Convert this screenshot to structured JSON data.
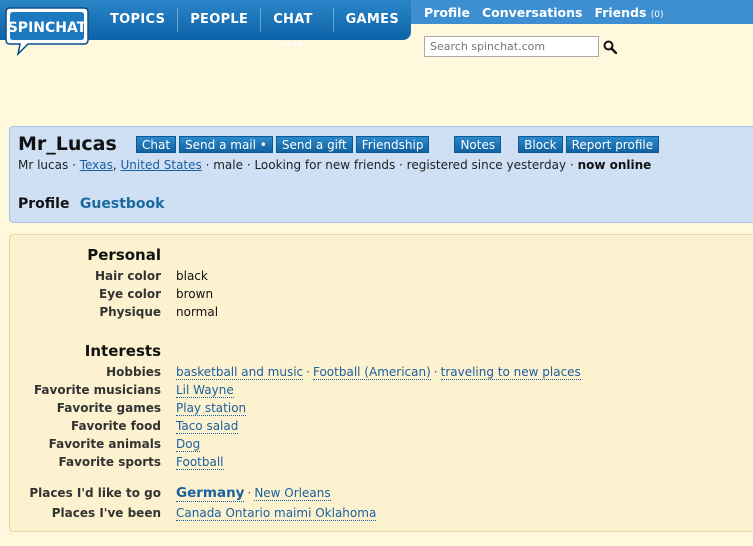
{
  "brand": {
    "logo_text": "SPINCHAT"
  },
  "main_nav": {
    "topics": "TOPICS",
    "people": "PEOPLE",
    "chat": "CHAT",
    "games": "GAMES"
  },
  "user_nav": {
    "profile": "Profile",
    "conversations": "Conversations",
    "friends": "Friends",
    "friends_count": "(0)"
  },
  "search": {
    "placeholder": "Search spinchat.com"
  },
  "profile": {
    "username": "Mr_Lucas",
    "actions": {
      "chat": "Chat",
      "send_mail": "Send a mail •",
      "send_gift": "Send a gift",
      "friendship": "Friendship",
      "notes": "Notes",
      "block": "Block",
      "report": "Report profile"
    },
    "display_name": "Mr lucas",
    "state": "Texas",
    "country": "United States",
    "gender": "male",
    "looking_for": "Looking for new friends",
    "registered": "registered since yesterday",
    "status": "now online",
    "tabs": {
      "profile": "Profile",
      "guestbook": "Guestbook"
    }
  },
  "personal": {
    "title": "Personal",
    "hair_color": {
      "label": "Hair color",
      "value": "black"
    },
    "eye_color": {
      "label": "Eye color",
      "value": "brown"
    },
    "physique": {
      "label": "Physique",
      "value": "normal"
    }
  },
  "interests": {
    "title": "Interests",
    "hobbies": {
      "label": "Hobbies",
      "values": [
        "basketball and music",
        "Football (American)",
        "traveling to new places"
      ]
    },
    "musicians": {
      "label": "Favorite musicians",
      "value": "Lil Wayne"
    },
    "games": {
      "label": "Favorite games",
      "value": "Play station"
    },
    "food": {
      "label": "Favorite food",
      "value": "Taco salad"
    },
    "animals": {
      "label": "Favorite animals",
      "value": "Dog"
    },
    "sports": {
      "label": "Favorite sports",
      "value": "Football"
    }
  },
  "places": {
    "like_to_go": {
      "label": "Places I'd like to go",
      "values": [
        "Germany",
        "New Orleans"
      ]
    },
    "been": {
      "label": "Places I've been",
      "value": "Canada Ontario maimi Oklahoma"
    }
  },
  "colors": {
    "nav_blue": "#1a72b8",
    "header_bg": "#cfe0f5",
    "details_bg": "#fdf2cf",
    "link": "#1a5f9e",
    "page_bg": "#fff8dd"
  },
  "icons": {
    "search": "magnifier-icon",
    "chat_arrows": "arrows-icon"
  }
}
